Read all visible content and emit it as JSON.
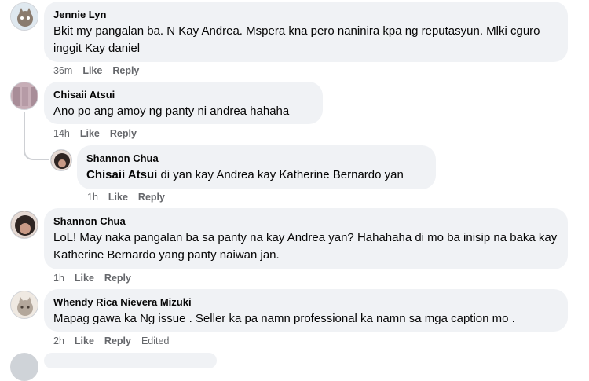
{
  "comments": [
    {
      "author": "Jennie Lyn",
      "text": "Bkit my pangalan ba. N Kay Andrea. Mspera kna pero naninira kpa ng reputasyun. Mlki cguro inggit Kay daniel",
      "time": "36m",
      "like": "Like",
      "reply": "Reply"
    },
    {
      "author": "Chisaii Atsui",
      "text": "Ano po ang amoy ng panty ni andrea hahaha",
      "time": "14h",
      "like": "Like",
      "reply": "Reply"
    },
    {
      "author": "Shannon Chua",
      "mention": "Chisaii Atsui",
      "text": " di yan kay Andrea kay Katherine Bernardo yan",
      "time": "1h",
      "like": "Like",
      "reply": "Reply"
    },
    {
      "author": "Shannon Chua",
      "text": "LoL! May naka pangalan ba sa panty na kay Andrea yan? Hahahaha di mo ba inisip na baka kay Katherine Bernardo yang panty naiwan jan.",
      "time": "1h",
      "like": "Like",
      "reply": "Reply"
    },
    {
      "author": "Whendy Rica Nievera Mizuki",
      "text": "Mapag gawa ka Ng issue . Seller ka pa namn professional ka namn sa mga caption mo .",
      "time": "2h",
      "like": "Like",
      "reply": "Reply",
      "edited": "Edited"
    }
  ],
  "colors": {
    "bubble": "#f0f2f5",
    "meta": "#65676b",
    "text": "#050505"
  }
}
